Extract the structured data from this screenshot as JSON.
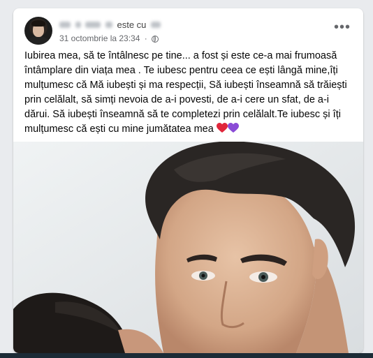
{
  "post": {
    "author_suffix": "este cu",
    "timestamp": "31 octombrie la 23:34",
    "separator": "·",
    "privacy_icon": "globe-icon",
    "more_icon": "more-options-icon",
    "more_label": "•••",
    "text": "Iubirea mea, să te întâlnesc pe tine... a fost și este  ce-a mai frumoasă întâmplare din viața mea . Te iubesc pentru ceea ce ești lângă mine,îți mulțumesc că Mă iubești și ma respecții, Să iubești înseamnă să trăiești prin celălalt, să simți nevoia de a-i povesti, de a-i cere un sfat, de a-i dărui. Să iubești înseamnă să te completezi prin celălalt.Te iubesc și îți mulțumesc că ești cu mine jumătatea mea",
    "emoji_1": "red-heart-emoji",
    "emoji_2": "purple-heart-emoji"
  },
  "colors": {
    "card_bg": "#ffffff",
    "page_bg": "#e9ebee",
    "meta_text": "#65676b",
    "bottom_bar": "#1c2b36"
  }
}
